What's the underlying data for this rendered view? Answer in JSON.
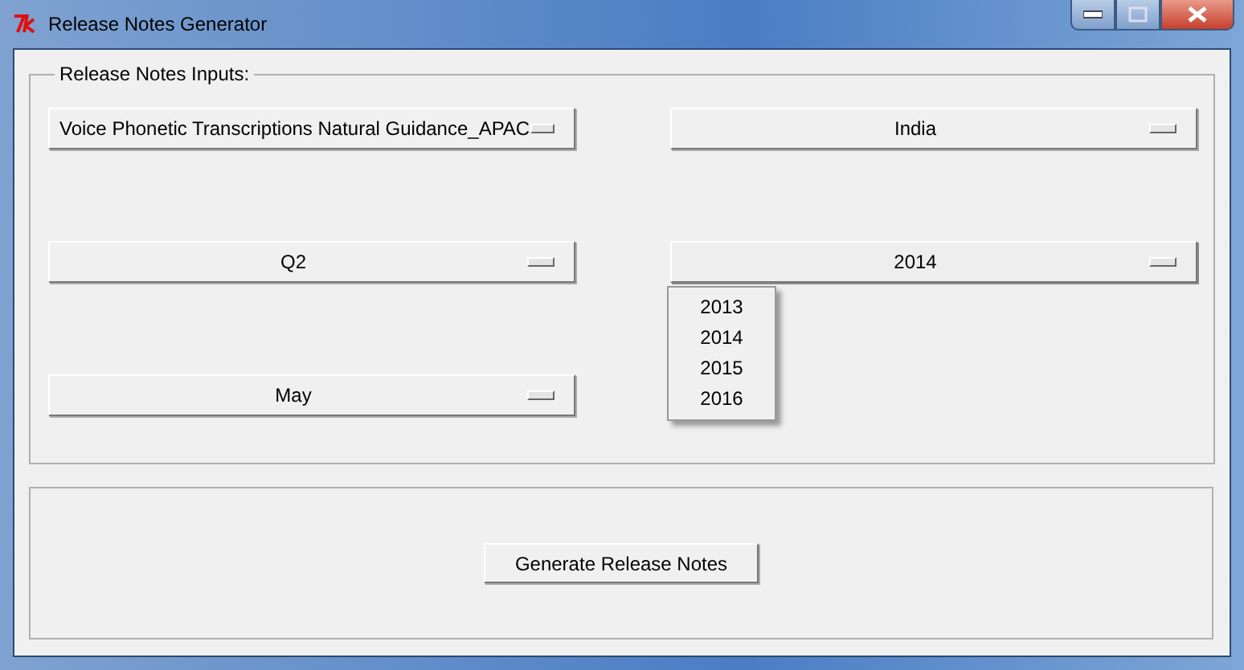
{
  "window": {
    "title": "Release Notes Generator"
  },
  "inputs_group": {
    "label": "Release Notes Inputs:",
    "dropdowns": [
      {
        "value": "Voice Phonetic Transcriptions Natural Guidance_APAC",
        "menu_open": false
      },
      {
        "value": "India",
        "menu_open": false
      },
      {
        "value": "Q2",
        "menu_open": false
      },
      {
        "value": "2014",
        "menu_open": true
      },
      {
        "value": "May",
        "menu_open": false
      }
    ]
  },
  "dropdown_menu": {
    "items": [
      "2013",
      "2014",
      "2015",
      "2016"
    ]
  },
  "generate_button": {
    "label": "Generate Release Notes"
  }
}
